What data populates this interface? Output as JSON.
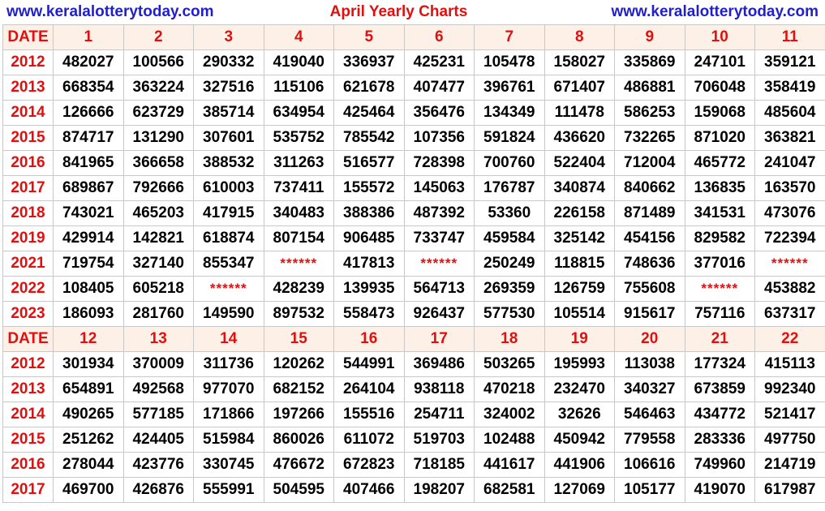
{
  "header": {
    "site_left": "www.keralalotterytoday.com",
    "title": "April Yearly Charts",
    "site_right": "www.keralalotterytoday.com"
  },
  "colors": {
    "accent": "#e01010",
    "link": "#1f1fcc",
    "header_bg": "#fdf0e6",
    "text": "#000000"
  },
  "sections": [
    {
      "label": "DATE",
      "days": [
        "1",
        "2",
        "3",
        "4",
        "5",
        "6",
        "7",
        "8",
        "9",
        "10",
        "11"
      ],
      "rows": [
        {
          "year": "2012",
          "values": [
            "482027",
            "100566",
            "290332",
            "419040",
            "336937",
            "425231",
            "105478",
            "158027",
            "335869",
            "247101",
            "359121"
          ]
        },
        {
          "year": "2013",
          "values": [
            "668354",
            "363224",
            "327516",
            "115106",
            "621678",
            "407477",
            "396761",
            "671407",
            "486881",
            "706048",
            "358419"
          ]
        },
        {
          "year": "2014",
          "values": [
            "126666",
            "623729",
            "385714",
            "634954",
            "425464",
            "356476",
            "134349",
            "111478",
            "586253",
            "159068",
            "485604"
          ]
        },
        {
          "year": "2015",
          "values": [
            "874717",
            "131290",
            "307601",
            "535752",
            "785542",
            "107356",
            "591824",
            "436620",
            "732265",
            "871020",
            "363821"
          ]
        },
        {
          "year": "2016",
          "values": [
            "841965",
            "366658",
            "388532",
            "311263",
            "516577",
            "728398",
            "700760",
            "522404",
            "712004",
            "465772",
            "241047"
          ]
        },
        {
          "year": "2017",
          "values": [
            "689867",
            "792666",
            "610003",
            "737411",
            "155572",
            "145063",
            "176787",
            "340874",
            "840662",
            "136835",
            "163570"
          ]
        },
        {
          "year": "2018",
          "values": [
            "743021",
            "465203",
            "417915",
            "340483",
            "388386",
            "487392",
            "53360",
            "226158",
            "871489",
            "341531",
            "473076"
          ]
        },
        {
          "year": "2019",
          "values": [
            "429914",
            "142821",
            "618874",
            "807154",
            "906485",
            "733747",
            "459584",
            "325142",
            "454156",
            "829582",
            "722394"
          ]
        },
        {
          "year": "2021",
          "values": [
            "719754",
            "327140",
            "855347",
            "******",
            "417813",
            "******",
            "250249",
            "118815",
            "748636",
            "377016",
            "******"
          ]
        },
        {
          "year": "2022",
          "values": [
            "108405",
            "605218",
            "******",
            "428239",
            "139935",
            "564713",
            "269359",
            "126759",
            "755608",
            "******",
            "453882"
          ]
        },
        {
          "year": "2023",
          "values": [
            "186093",
            "281760",
            "149590",
            "897532",
            "558473",
            "926437",
            "577530",
            "105514",
            "915617",
            "757116",
            "637317"
          ]
        }
      ]
    },
    {
      "label": "DATE",
      "days": [
        "12",
        "13",
        "14",
        "15",
        "16",
        "17",
        "18",
        "19",
        "20",
        "21",
        "22"
      ],
      "rows": [
        {
          "year": "2012",
          "values": [
            "301934",
            "370009",
            "311736",
            "120262",
            "544991",
            "369486",
            "503265",
            "195993",
            "113038",
            "177324",
            "415113"
          ]
        },
        {
          "year": "2013",
          "values": [
            "654891",
            "492568",
            "977070",
            "682152",
            "264104",
            "938118",
            "470218",
            "232470",
            "340327",
            "673859",
            "992340"
          ]
        },
        {
          "year": "2014",
          "values": [
            "490265",
            "577185",
            "171866",
            "197266",
            "155516",
            "254711",
            "324002",
            "32626",
            "546463",
            "434772",
            "521417"
          ]
        },
        {
          "year": "2015",
          "values": [
            "251262",
            "424405",
            "515984",
            "860026",
            "611072",
            "519703",
            "102488",
            "450942",
            "779558",
            "283336",
            "497750"
          ]
        },
        {
          "year": "2016",
          "values": [
            "278044",
            "423776",
            "330745",
            "476672",
            "672823",
            "718185",
            "441617",
            "441906",
            "106616",
            "749960",
            "214719"
          ]
        },
        {
          "year": "2017",
          "values": [
            "469700",
            "426876",
            "555991",
            "504595",
            "407466",
            "198207",
            "682581",
            "127069",
            "105177",
            "419070",
            "617987"
          ]
        }
      ]
    }
  ]
}
